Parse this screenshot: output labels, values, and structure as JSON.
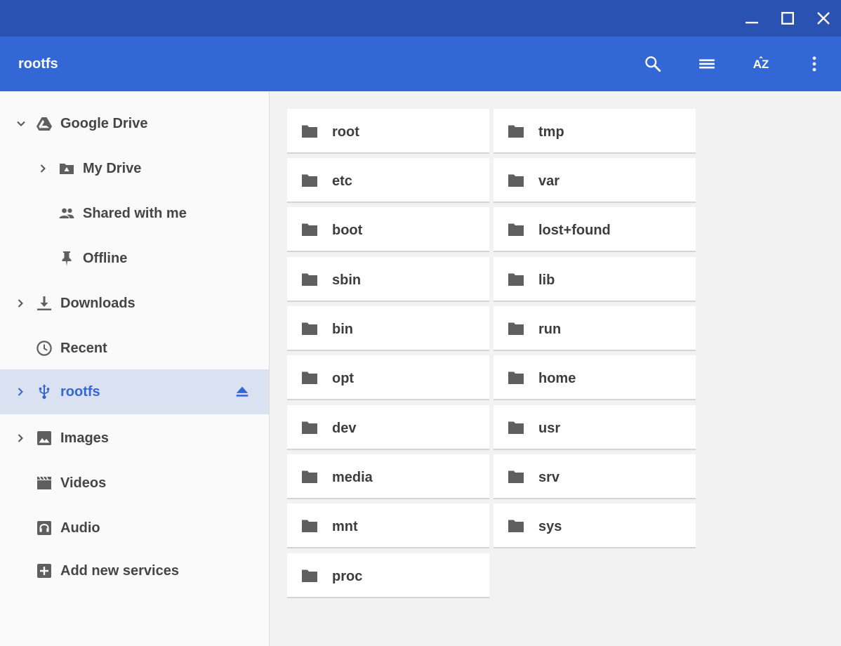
{
  "window": {
    "controls": [
      {
        "name": "minimize-button",
        "icon": "minimize-icon"
      },
      {
        "name": "maximize-button",
        "icon": "maximize-icon"
      },
      {
        "name": "close-button",
        "icon": "close-icon"
      }
    ]
  },
  "appbar": {
    "title": "rootfs",
    "sort_label": "AZ",
    "actions": [
      "search-icon",
      "list-view-icon",
      "sort-az-icon",
      "more-vert-icon"
    ]
  },
  "colors": {
    "titlebar": "#2a52b3",
    "appbar": "#3367d6",
    "selected_bg": "#dae1f0",
    "selected_text": "#3367d6",
    "content_bg": "#f2f2f2"
  },
  "sidebar": {
    "items": [
      {
        "label": "Google Drive",
        "icon": "google-drive-icon",
        "arrow": "expanded",
        "level": 0
      },
      {
        "label": "My Drive",
        "icon": "my-drive-icon",
        "arrow": "collapsed",
        "level": 1
      },
      {
        "label": "Shared with me",
        "icon": "people-icon",
        "arrow": "none",
        "level": 1
      },
      {
        "label": "Offline",
        "icon": "pin-icon",
        "arrow": "none",
        "level": 1
      },
      {
        "label": "Downloads",
        "icon": "download-icon",
        "arrow": "collapsed",
        "level": 0
      },
      {
        "label": "Recent",
        "icon": "clock-icon",
        "arrow": "none",
        "level": 0
      },
      {
        "label": "rootfs",
        "icon": "usb-icon",
        "arrow": "collapsed",
        "level": 0,
        "selected": true,
        "eject": "eject-icon"
      },
      {
        "label": "Images",
        "icon": "image-icon",
        "arrow": "collapsed",
        "level": 0
      },
      {
        "label": "Videos",
        "icon": "video-icon",
        "arrow": "none",
        "level": 0
      },
      {
        "label": "Audio",
        "icon": "audio-icon",
        "arrow": "none",
        "level": 0
      },
      {
        "label": "Add new services",
        "icon": "add-box-icon",
        "arrow": "none",
        "level": 0
      }
    ]
  },
  "folders": [
    {
      "name": "root"
    },
    {
      "name": "tmp"
    },
    {
      "name": "etc"
    },
    {
      "name": "var"
    },
    {
      "name": "boot"
    },
    {
      "name": "lost+found"
    },
    {
      "name": "sbin"
    },
    {
      "name": "lib"
    },
    {
      "name": "bin"
    },
    {
      "name": "run"
    },
    {
      "name": "opt"
    },
    {
      "name": "home"
    },
    {
      "name": "dev"
    },
    {
      "name": "usr"
    },
    {
      "name": "media"
    },
    {
      "name": "srv"
    },
    {
      "name": "mnt"
    },
    {
      "name": "sys"
    },
    {
      "name": "proc"
    }
  ]
}
